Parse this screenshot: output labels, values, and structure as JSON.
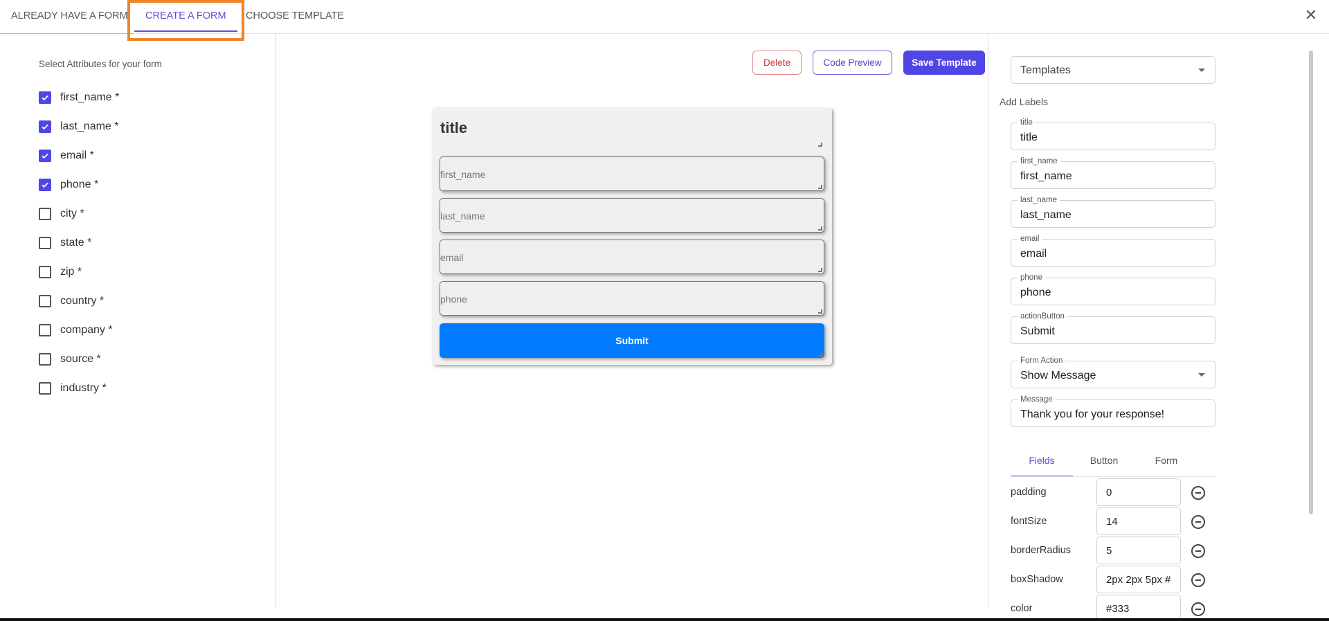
{
  "tabs": {
    "already_have": "ALREADY HAVE A FORM",
    "create": "CREATE A FORM",
    "choose": "CHOOSE TEMPLATE"
  },
  "left": {
    "title": "Select Attributes for your form",
    "attributes": [
      {
        "label": "first_name *",
        "checked": true
      },
      {
        "label": "last_name *",
        "checked": true
      },
      {
        "label": "email *",
        "checked": true
      },
      {
        "label": "phone *",
        "checked": true
      },
      {
        "label": "city *",
        "checked": false
      },
      {
        "label": "state *",
        "checked": false
      },
      {
        "label": "zip *",
        "checked": false
      },
      {
        "label": "country *",
        "checked": false
      },
      {
        "label": "company *",
        "checked": false
      },
      {
        "label": "source *",
        "checked": false
      },
      {
        "label": "industry *",
        "checked": false
      }
    ]
  },
  "actions": {
    "delete": "Delete",
    "code_preview": "Code Preview",
    "save_template": "Save Template"
  },
  "preview": {
    "title": "title",
    "fields": [
      "first_name",
      "last_name",
      "email",
      "phone"
    ],
    "submit": "Submit"
  },
  "right": {
    "templates": "Templates",
    "add_labels": "Add Labels",
    "labels": [
      {
        "label": "title",
        "value": "title"
      },
      {
        "label": "first_name",
        "value": "first_name"
      },
      {
        "label": "last_name",
        "value": "last_name"
      },
      {
        "label": "email",
        "value": "email"
      },
      {
        "label": "phone",
        "value": "phone"
      },
      {
        "label": "actionButton",
        "value": "Submit"
      }
    ],
    "form_action": {
      "label": "Form Action",
      "value": "Show Message"
    },
    "message": {
      "label": "Message",
      "value": "Thank you for your response!"
    },
    "subtabs": [
      "Fields",
      "Button",
      "Form"
    ],
    "properties": [
      {
        "name": "padding",
        "value": "0"
      },
      {
        "name": "fontSize",
        "value": "14"
      },
      {
        "name": "borderRadius",
        "value": "5"
      },
      {
        "name": "boxShadow",
        "value": "2px 2px 5px #"
      },
      {
        "name": "color",
        "value": "#333"
      }
    ]
  },
  "colors": {
    "accent": "#4f46e5",
    "submit": "#007bff",
    "highlight": "#f0842a"
  }
}
